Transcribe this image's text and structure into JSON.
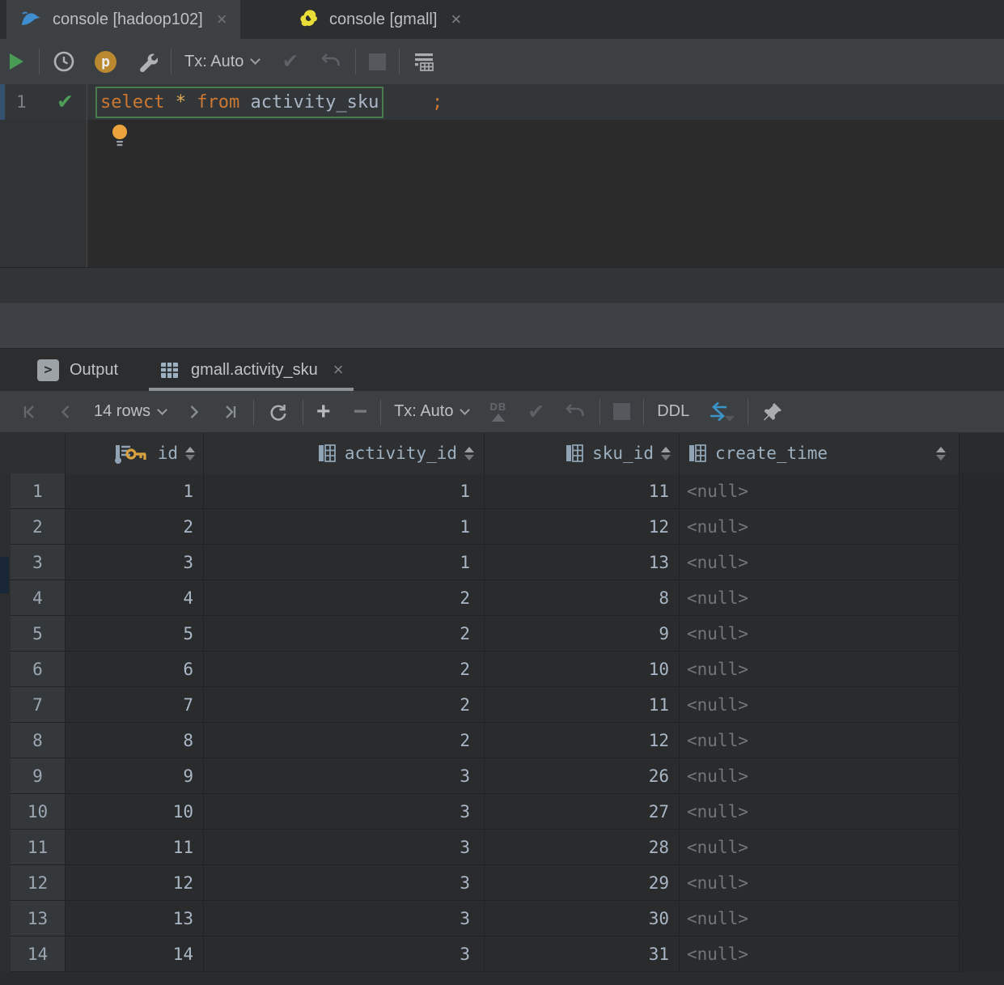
{
  "window_tabs": [
    {
      "label": "console [hadoop102]",
      "icon": "mysql-dolphin-icon",
      "close": "×",
      "active": true
    },
    {
      "label": "console [gmall]",
      "icon": "gmall-mascot-icon",
      "close": "×",
      "active": false
    }
  ],
  "editor_toolbar": {
    "tx_label": "Tx: Auto"
  },
  "editor": {
    "line_number": "1",
    "status_check": "✔",
    "sql": {
      "kw_select": "select",
      "star": "*",
      "kw_from": "from",
      "identifier": "activity_sku",
      "semicolon": ";"
    }
  },
  "output_panel": {
    "output_tab_label": "Output",
    "result_tab_label": "gmall.activity_sku",
    "result_tab_close": "×",
    "output_icon_glyph": ">"
  },
  "grid_toolbar": {
    "rows_label": "14 rows",
    "tx_label": "Tx: Auto",
    "ddl_label": "DDL",
    "plus_glyph": "+",
    "minus_glyph": "−",
    "db_upload_label": "DB"
  },
  "table": {
    "columns": [
      {
        "name": "id",
        "primary_key": true
      },
      {
        "name": "activity_id",
        "primary_key": false
      },
      {
        "name": "sku_id",
        "primary_key": false
      },
      {
        "name": "create_time",
        "primary_key": false
      }
    ],
    "rows": [
      {
        "num": "1",
        "id": "1",
        "activity_id": "1",
        "sku_id": "11",
        "create_time": "<null>"
      },
      {
        "num": "2",
        "id": "2",
        "activity_id": "1",
        "sku_id": "12",
        "create_time": "<null>"
      },
      {
        "num": "3",
        "id": "3",
        "activity_id": "1",
        "sku_id": "13",
        "create_time": "<null>"
      },
      {
        "num": "4",
        "id": "4",
        "activity_id": "2",
        "sku_id": "8",
        "create_time": "<null>"
      },
      {
        "num": "5",
        "id": "5",
        "activity_id": "2",
        "sku_id": "9",
        "create_time": "<null>"
      },
      {
        "num": "6",
        "id": "6",
        "activity_id": "2",
        "sku_id": "10",
        "create_time": "<null>"
      },
      {
        "num": "7",
        "id": "7",
        "activity_id": "2",
        "sku_id": "11",
        "create_time": "<null>"
      },
      {
        "num": "8",
        "id": "8",
        "activity_id": "2",
        "sku_id": "12",
        "create_time": "<null>"
      },
      {
        "num": "9",
        "id": "9",
        "activity_id": "3",
        "sku_id": "26",
        "create_time": "<null>"
      },
      {
        "num": "10",
        "id": "10",
        "activity_id": "3",
        "sku_id": "27",
        "create_time": "<null>"
      },
      {
        "num": "11",
        "id": "11",
        "activity_id": "3",
        "sku_id": "28",
        "create_time": "<null>"
      },
      {
        "num": "12",
        "id": "12",
        "activity_id": "3",
        "sku_id": "29",
        "create_time": "<null>"
      },
      {
        "num": "13",
        "id": "13",
        "activity_id": "3",
        "sku_id": "30",
        "create_time": "<null>"
      },
      {
        "num": "14",
        "id": "14",
        "activity_id": "3",
        "sku_id": "31",
        "create_time": "<null>"
      }
    ]
  },
  "colors": {
    "accent_blue": "#3b94c9",
    "key_gold": "#d8a13f",
    "run_green": "#499c54",
    "keyword_orange": "#cc7832",
    "toolbar_bg": "#3d4043",
    "editor_bg": "#2b2b2b",
    "grid_cell_bg": "#292b2c"
  }
}
